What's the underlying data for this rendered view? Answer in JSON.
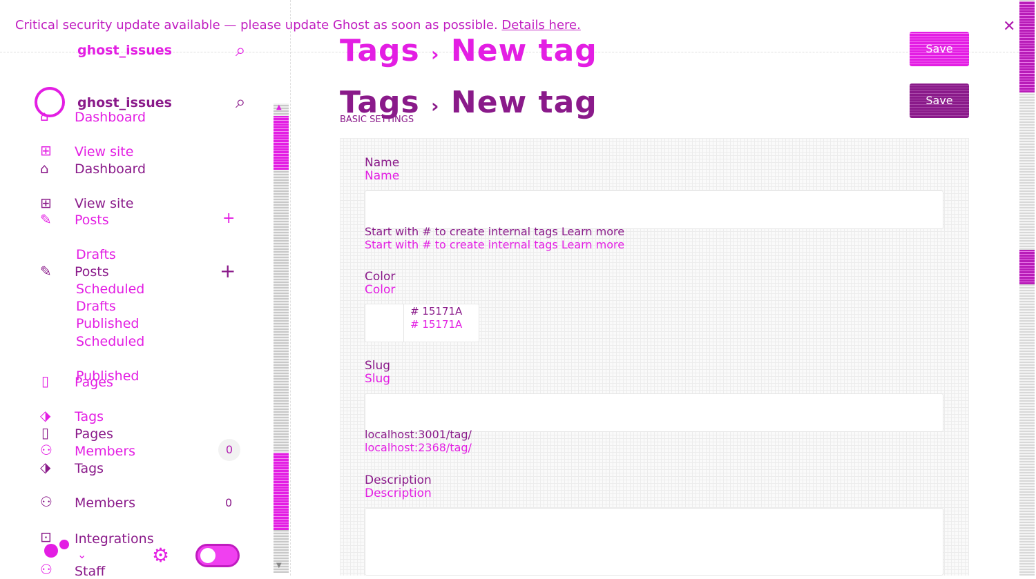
{
  "banner": {
    "message": "Critical security update available — please update Ghost as soon as possible.",
    "link": "Details here.",
    "close_icon": "close-icon"
  },
  "sidebar": {
    "site_title": "ghost_issues",
    "items": [
      {
        "label": "Dashboard",
        "icon": "home-icon"
      },
      {
        "label": "View site",
        "icon": "window-icon"
      },
      {
        "label": "Posts",
        "icon": "edit-icon"
      },
      {
        "label": "Drafts"
      },
      {
        "label": "Scheduled"
      },
      {
        "label": "Published"
      },
      {
        "label": "Pages",
        "icon": "page-icon"
      },
      {
        "label": "Tags",
        "icon": "tag-icon"
      },
      {
        "label": "Members",
        "icon": "members-icon",
        "count": "0"
      },
      {
        "label": "Integrations",
        "icon": "integrations-icon"
      },
      {
        "label": "Staff",
        "icon": "staff-icon"
      }
    ]
  },
  "header": {
    "breadcrumb": "Tags",
    "separator": "›",
    "title": "New tag",
    "save_label": "Save",
    "section": "BASIC SETTINGS"
  },
  "form": {
    "name_label": "Name",
    "name_value": "",
    "name_hint": "Start with # to create internal tags Learn more",
    "color_label": "Color",
    "color_value": "# 15171A",
    "slug_label": "Slug",
    "slug_value": "",
    "slug_hint_a": "localhost:3001/tag/",
    "slug_hint_b": "localhost:2368/tag/",
    "description_label": "Description",
    "description_value": ""
  }
}
